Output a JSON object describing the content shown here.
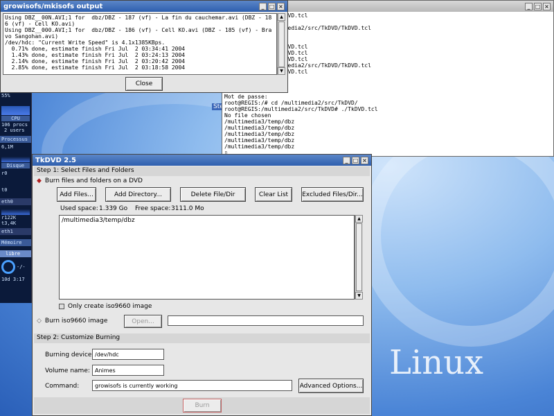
{
  "wallpaper": {
    "logo_text": "Linux"
  },
  "terminal": {
    "lines": [
      "edia2/src/TkDVD/TkDVD.tcl",
      "",
      "            /multimedia2/src/TkDVD/TkDVD.tcl",
      "",
      "TkDVD.tcl &",
      "edia2/src/TkDVD/TkDVD.tcl",
      "edia2/src/TkDVD/TkDVD.tcl",
      "edia2/src/TkDVD/TkDVD.tcl",
      "            /multimedia2/src/TkDVD/TkDVD.tcl",
      "edia2/src/TkDVD/TkDVD.tcl",
      "",
      "",
      "",
      "Mot de passe:",
      "root@REGIS:/# cd /multimedia2/src/TkDVD/",
      "root@REGIS:/multimedia2/src/TkDVD# ./TkDVD.tcl",
      "No file chosen",
      "/multimedia3/temp/dbz",
      "/multimedia3/temp/dbz",
      "/multimedia3/temp/dbz",
      "/multimedia3/temp/dbz",
      "/multimedia3/temp/dbz",
      "▯"
    ]
  },
  "output_window": {
    "title": "growisofs/mkisofs output",
    "lines": [
      "Using DBZ__00N.AVI;1 for  dbz/DBZ - 187 (vf) - La fin du cauchemar.avi (DBZ - 18",
      "6 (vf) - Cell KO.avi)",
      "Using DBZ__000.AVI;1 for  dbz/DBZ - 186 (vf) - Cell KO.avi (DBZ - 185 (vf) - Bra",
      "vo Sangohan.avi)",
      "/dev/hdc: \"Current Write Speed\" is 4.1x1385KBps.",
      "  0.71% done, estimate finish Fri Jul  2 03:34:41 2004",
      "  1.43% done, estimate finish Fri Jul  2 03:24:13 2004",
      "  2.14% done, estimate finish Fri Jul  2 03:20:42 2004",
      "  2.85% done, estimate finish Fri Jul  2 03:18:58 2004"
    ],
    "close_label": "Close"
  },
  "monitor": {
    "cpu_percent": "55%",
    "cpu_label": "CPU",
    "procs": "106 procs",
    "users": "2 users",
    "processus_label": "Processus",
    "processus_value": "6,1M",
    "disque_label": "Disque",
    "r_value": "r0",
    "t_value": "t0",
    "eth0_label": "eth0",
    "eth0_r": "r122K",
    "eth0_t": "t3,4K",
    "eth1_label": "eth1",
    "memoire_label": "Mémoire",
    "libre_label": "libre",
    "uptime": "10d  3:17",
    "net_indicator": "-/-"
  },
  "desktop_partial_label": "Ste",
  "tkdvd": {
    "title": "TkDVD 2.5",
    "step1_title": "Step 1: Select Files and Folders",
    "burn_files_label": "Burn files and folders on a DVD",
    "buttons": {
      "add_files": "Add Files...",
      "add_directory": "Add Directory...",
      "delete": "Delete File/Dir",
      "clear": "Clear List",
      "excluded": "Excluded Files/Dir..."
    },
    "used_space_label": "Used space:",
    "used_space_value": "1.339 Go",
    "free_space_label": "Free space:",
    "free_space_value": "3111.0 Mo",
    "file_list": [
      "/multimedia3/temp/dbz"
    ],
    "only_iso_label": "Only create iso9660 image",
    "burn_iso_label": "Burn iso9660 image",
    "open_label": "Open...",
    "iso_path": "",
    "step2_title": "Step 2: Customize Burning",
    "burning_device_label": "Burning device:",
    "burning_device_value": "/dev/hdc",
    "volume_name_label": "Volume name:",
    "volume_name_value": "Animes",
    "command_label": "Command:",
    "command_value": "growisofs is currently working",
    "advanced_label": "Advanced Options...",
    "burn_label": "Burn"
  }
}
